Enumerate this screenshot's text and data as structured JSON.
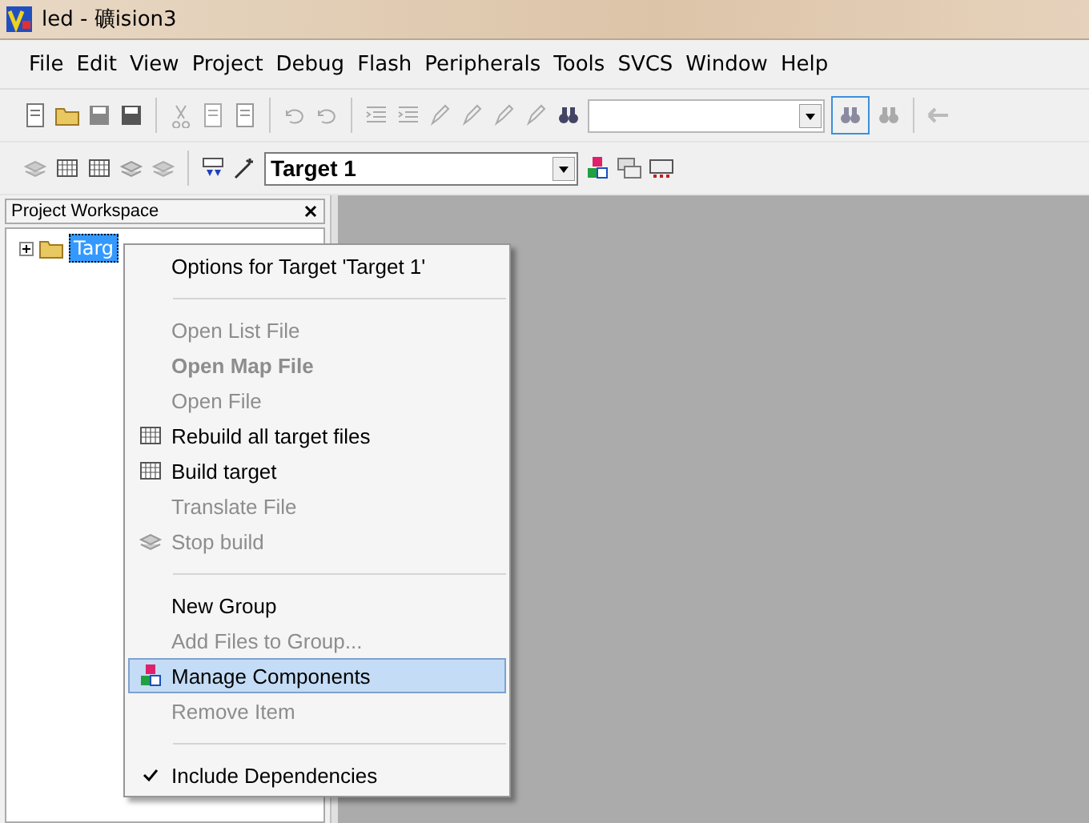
{
  "window": {
    "title": "led  - 礦ision3"
  },
  "menu_bar": [
    "File",
    "Edit",
    "View",
    "Project",
    "Debug",
    "Flash",
    "Peripherals",
    "Tools",
    "SVCS",
    "Window",
    "Help"
  ],
  "toolbar": {
    "target_select": {
      "value": "Target 1"
    }
  },
  "workspace": {
    "title": "Project Workspace",
    "tree": [
      {
        "label": "Targ",
        "selected": true,
        "expanded": false
      }
    ]
  },
  "context_menu": [
    {
      "kind": "plain",
      "label": "Options for Target 'Target 1'",
      "disabled": false,
      "bold": false,
      "selected": false
    },
    {
      "kind": "separator"
    },
    {
      "kind": "plain",
      "label": "Open List File",
      "disabled": true,
      "bold": false,
      "selected": false
    },
    {
      "kind": "plain",
      "label": "Open Map File",
      "disabled": true,
      "bold": true,
      "selected": false
    },
    {
      "kind": "plain",
      "label": "Open File",
      "disabled": true,
      "bold": false,
      "selected": false
    },
    {
      "kind": "rebuild",
      "label": "Rebuild all target files",
      "disabled": false,
      "bold": false,
      "selected": false
    },
    {
      "kind": "build",
      "label": "Build target",
      "disabled": false,
      "bold": false,
      "selected": false
    },
    {
      "kind": "plain",
      "label": "Translate File",
      "disabled": true,
      "bold": false,
      "selected": false
    },
    {
      "kind": "stop",
      "label": "Stop build",
      "disabled": true,
      "bold": false,
      "selected": false
    },
    {
      "kind": "separator"
    },
    {
      "kind": "plain",
      "label": "New Group",
      "disabled": false,
      "bold": false,
      "selected": false
    },
    {
      "kind": "plain",
      "label": "Add Files to Group...",
      "disabled": true,
      "bold": false,
      "selected": false
    },
    {
      "kind": "components",
      "label": "Manage Components",
      "disabled": false,
      "bold": false,
      "selected": true
    },
    {
      "kind": "plain",
      "label": "Remove Item",
      "disabled": true,
      "bold": false,
      "selected": false
    },
    {
      "kind": "separator"
    },
    {
      "kind": "plain",
      "label": "Include Dependencies",
      "disabled": false,
      "bold": false,
      "selected": false,
      "checked": true
    }
  ]
}
